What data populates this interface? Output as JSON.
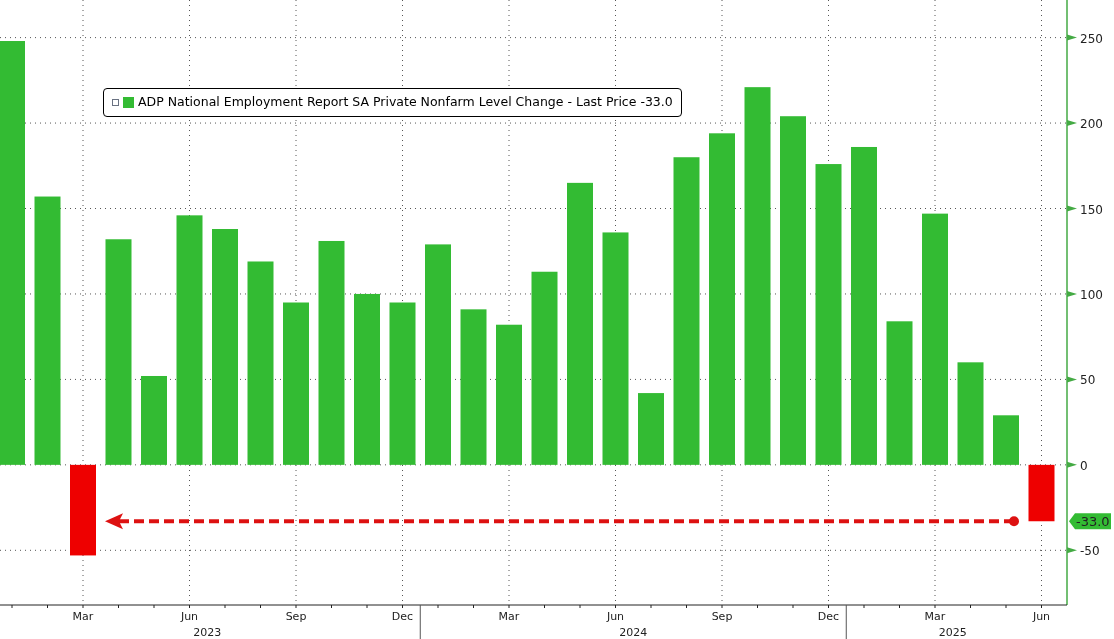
{
  "chart": {
    "legend": {
      "suffix": "- Last Price -33.0",
      "expanded": false
    },
    "year_labels": [
      "2023",
      "2024",
      "2025"
    ],
    "chart_data": {
      "type": "bar",
      "stacked": true,
      "grid": true,
      "categories": [
        null,
        null,
        "Mar",
        null,
        null,
        "Jun",
        null,
        null,
        "Sep",
        null,
        null,
        "Dec",
        null,
        null,
        "Mar",
        null,
        null,
        "Jun",
        null,
        null,
        "Sep",
        null,
        null,
        "Dec",
        null,
        null,
        "Mar",
        null,
        null,
        "Jun"
      ],
      "series": [
        {
          "name": "ADP National Employment Report SA Private Nonfarm Level Change",
          "color": "#33bb33",
          "values": [
            248,
            157,
            null,
            132,
            52,
            146,
            138,
            119,
            95,
            131,
            100,
            95,
            129,
            91,
            82,
            113,
            165,
            136,
            42,
            180,
            194,
            221,
            204,
            176,
            186,
            84,
            147,
            60,
            29,
            null
          ]
        },
        {
          "color": "#ee0000",
          "values": [
            null,
            null,
            -53,
            null,
            null,
            null,
            null,
            null,
            null,
            null,
            null,
            null,
            null,
            null,
            null,
            null,
            null,
            null,
            null,
            null,
            null,
            null,
            null,
            null,
            null,
            null,
            null,
            null,
            null,
            -33
          ]
        }
      ],
      "ylim": [
        -82,
        272
      ],
      "yticks": [
        -50,
        0,
        50,
        100,
        150,
        200,
        250
      ],
      "ref_lines": [
        {
          "axis": "y",
          "value": -33,
          "color": "#dd1111"
        }
      ],
      "annotations": [
        "-33.0"
      ]
    }
  }
}
